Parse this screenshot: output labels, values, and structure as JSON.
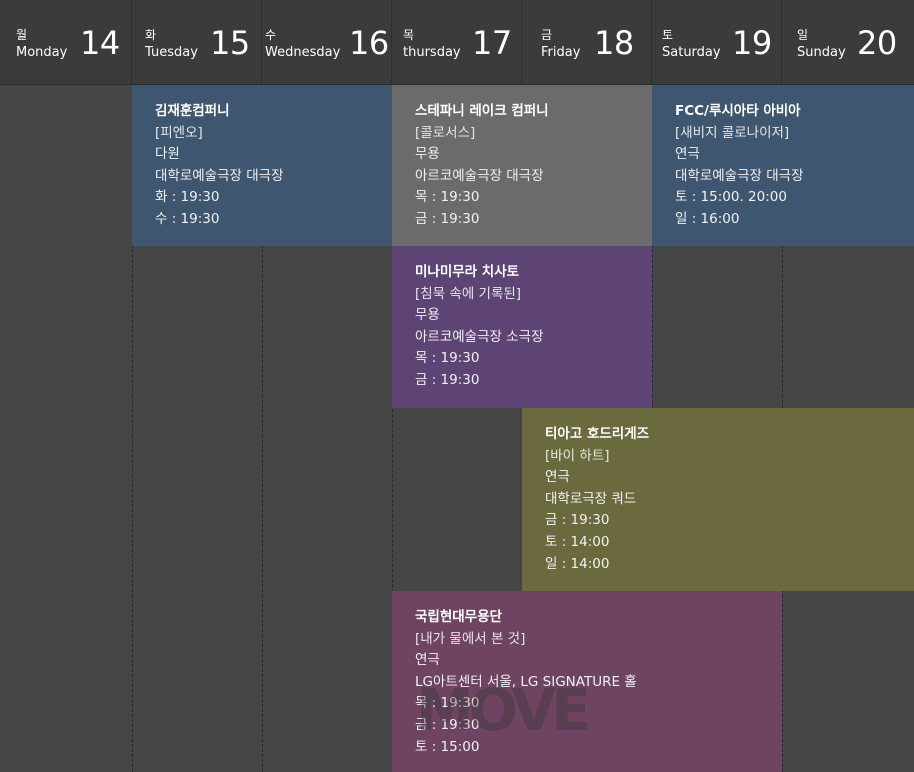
{
  "days": [
    {
      "kor": "월",
      "eng": "Monday",
      "num": "14"
    },
    {
      "kor": "화",
      "eng": "Tuesday",
      "num": "15"
    },
    {
      "kor": "수",
      "eng": "Wednesday",
      "num": "16"
    },
    {
      "kor": "목",
      "eng": "thursday",
      "num": "17"
    },
    {
      "kor": "금",
      "eng": "Friday",
      "num": "18"
    },
    {
      "kor": "토",
      "eng": "Saturday",
      "num": "19"
    },
    {
      "kor": "일",
      "eng": "Sunday",
      "num": "20"
    }
  ],
  "events": [
    {
      "title": "김재훈컴퍼니",
      "work": "[피엔오]",
      "genre": "다원",
      "venue": "대학로예술극장 대극장",
      "times": [
        "화 : 19:30",
        "수 : 19:30"
      ],
      "color": "#3e566f"
    },
    {
      "title": "스테파니 레이크 컴퍼니",
      "work": "[콜로서스]",
      "genre": "무용",
      "venue": "아르코예술극장 대극장",
      "times": [
        "목 : 19:30",
        "금 : 19:30"
      ],
      "color": "#6b6b6b"
    },
    {
      "title": "FCC/루시아타 아비아",
      "work": "[새비지 콜로나이저]",
      "genre": "연극",
      "venue": "대학로예술극장 대극장",
      "times": [
        "토 : 15:00. 20:00",
        "일 : 16:00"
      ],
      "color": "#3e566f"
    },
    {
      "title": "미나미무라 치사토",
      "work": "[침묵 속에 기록된]",
      "genre": "무용",
      "venue": "아르코예술극장 소극장",
      "times": [
        "목 : 19:30",
        "금 : 19:30"
      ],
      "color": "#5d4475"
    },
    {
      "title": "티아고 호드리게즈",
      "work": "[바이 하트]",
      "genre": "연극",
      "venue": "대학로극장 쿼드",
      "times": [
        "금 : 19:30",
        "토 : 14:00",
        "일 : 14:00"
      ],
      "color": "#6b6a3f"
    },
    {
      "title": "국립현대무용단",
      "work": "[내가 물에서 본 것]",
      "genre": "연극",
      "venue": "LG아트센터 서울, LG SIGNATURE 홀",
      "times": [
        "목 : 19:30",
        "금 : 19:30",
        "토 : 15:00"
      ],
      "color": "#6e4462"
    }
  ],
  "watermark": "MOVE"
}
